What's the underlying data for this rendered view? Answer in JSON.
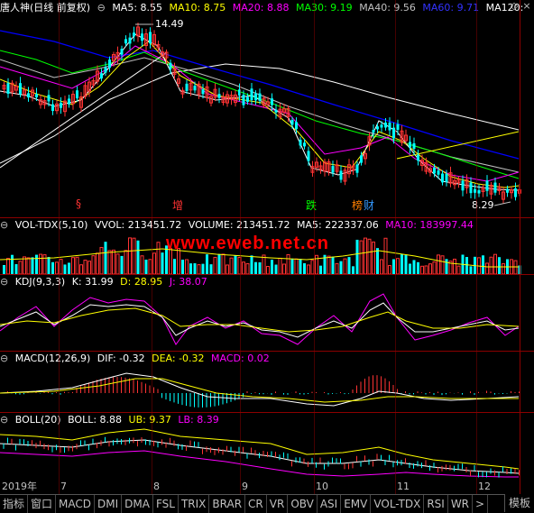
{
  "main_header": {
    "title": "唐人神(日线 前复权)",
    "ma5": "MA5: 8.55",
    "ma10": "MA10: 8.75",
    "ma20": "MA20: 8.88",
    "ma30": "MA30: 9.19",
    "ma40": "MA40: 9.56",
    "ma60": "MA60: 9.71",
    "ma120": "MA120:",
    "colors": {
      "ma5": "#ffffff",
      "ma10": "#ffff00",
      "ma20": "#ff00ff",
      "ma30": "#00ff00",
      "ma40": "#c0c0c0",
      "ma60": "#0000ff",
      "ma120": "#ffffff"
    }
  },
  "price_labels": {
    "high": "14.49",
    "low": "8.29"
  },
  "events": [
    {
      "text": "§",
      "color": "#ff3333"
    },
    {
      "text": "增",
      "color": "#ff3333"
    },
    {
      "text": "跌",
      "color": "#00ff00"
    },
    {
      "text": "榜",
      "color": "#ff8000"
    },
    {
      "text": "财",
      "color": "#3399ff"
    }
  ],
  "vol_header": {
    "name": "VOL-TDX(5,10)",
    "vvol": "VVOL: 213451.72",
    "volume": "VOLUME: 213451.72",
    "ma5": "MA5: 222337.06",
    "ma10": "MA10: 183997.44"
  },
  "watermark": "www.eweb.net.cn",
  "kdj_header": {
    "name": "KDJ(9,3,3)",
    "k": "K: 31.99",
    "d": "D: 28.95",
    "j": "J: 38.07"
  },
  "macd_header": {
    "name": "MACD(12,26,9)",
    "dif": "DIF: -0.32",
    "dea": "DEA: -0.32",
    "macd": "MACD: 0.02"
  },
  "boll_header": {
    "name": "BOLL(20)",
    "boll": "BOLL: 8.88",
    "ub": "UB: 9.37",
    "lb": "LB: 8.39"
  },
  "time_axis": [
    "2019年",
    "7",
    "8",
    "9",
    "10",
    "11",
    "12"
  ],
  "tabs": [
    "指标",
    "窗口",
    "MACD",
    "DMI",
    "DMA",
    "FSL",
    "TRIX",
    "BRAR",
    "CR",
    "VR",
    "OBV",
    "ASI",
    "EMV",
    "VOL-TDX",
    "RSI",
    "WR",
    ">"
  ],
  "tab_right": "模板",
  "window_buttons": [
    "◇",
    "×"
  ]
}
